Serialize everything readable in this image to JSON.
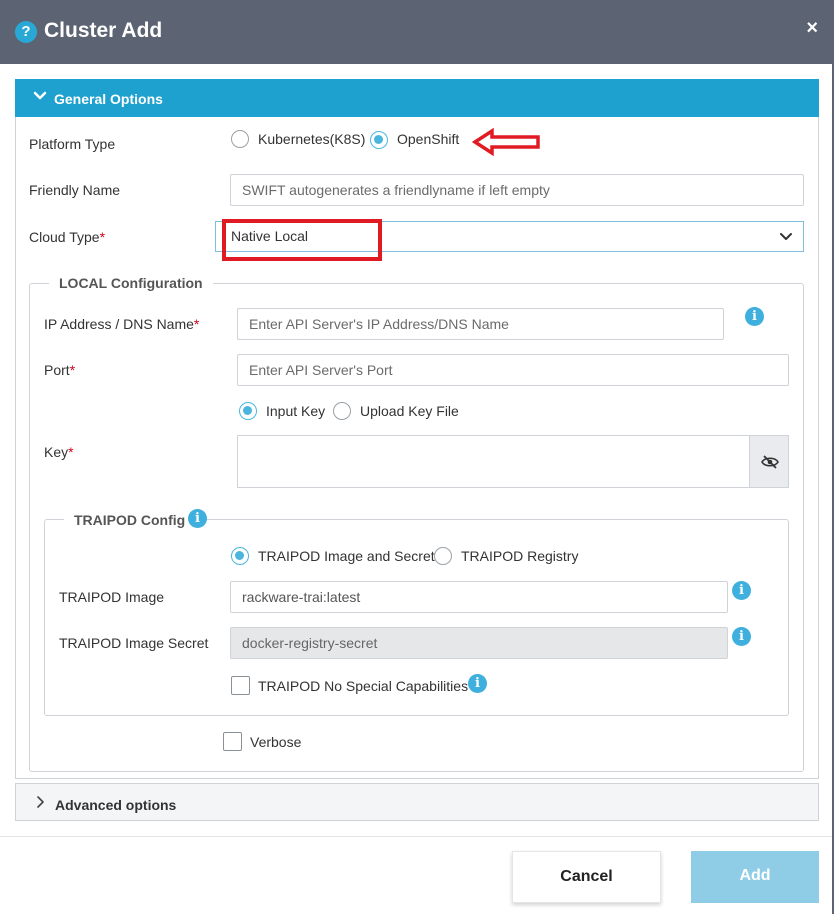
{
  "dialog": {
    "title": "Cluster Add",
    "close_glyph": "×",
    "help_glyph": "?"
  },
  "general": {
    "header": "General Options",
    "platform_type": {
      "label": "Platform Type",
      "options": [
        "Kubernetes(K8S)",
        "OpenShift"
      ],
      "selected": "OpenShift"
    },
    "friendly_name": {
      "label": "Friendly Name",
      "placeholder": "SWIFT autogenerates a friendlyname if left empty"
    },
    "cloud_type": {
      "label": "Cloud Type",
      "required_mark": "*",
      "value": "Native Local"
    }
  },
  "local_config": {
    "legend": "LOCAL Configuration",
    "ip": {
      "label": "IP Address / DNS Name",
      "required_mark": "*",
      "placeholder": "Enter API Server's IP Address/DNS Name"
    },
    "port": {
      "label": "Port",
      "required_mark": "*",
      "placeholder": "Enter API Server's Port"
    },
    "key_source": {
      "options": [
        "Input Key",
        "Upload Key File"
      ],
      "selected": "Input Key"
    },
    "key": {
      "label": "Key",
      "required_mark": "*",
      "value": ""
    }
  },
  "traipod": {
    "legend": "TRAIPOD Config",
    "mode": {
      "options": [
        "TRAIPOD Image and Secret",
        "TRAIPOD Registry"
      ],
      "selected": "TRAIPOD Image and Secret"
    },
    "image": {
      "label": "TRAIPOD Image",
      "value": "rackware-trai:latest"
    },
    "image_secret": {
      "label": "TRAIPOD Image Secret",
      "value": "docker-registry-secret"
    },
    "no_special_caps": {
      "label": "TRAIPOD No Special Capabilities",
      "checked": false
    }
  },
  "verbose": {
    "label": "Verbose",
    "checked": false
  },
  "advanced": {
    "header": "Advanced options"
  },
  "footer": {
    "cancel": "Cancel",
    "add": "Add"
  },
  "icons": {
    "info": "i"
  },
  "colors": {
    "header_bg": "#5c6373",
    "accent": "#1fa1cf",
    "radio_checked": "#4bb6dd",
    "required": "#d0021b",
    "annotation": "#e01b24",
    "add_button": "#8fcde6"
  }
}
